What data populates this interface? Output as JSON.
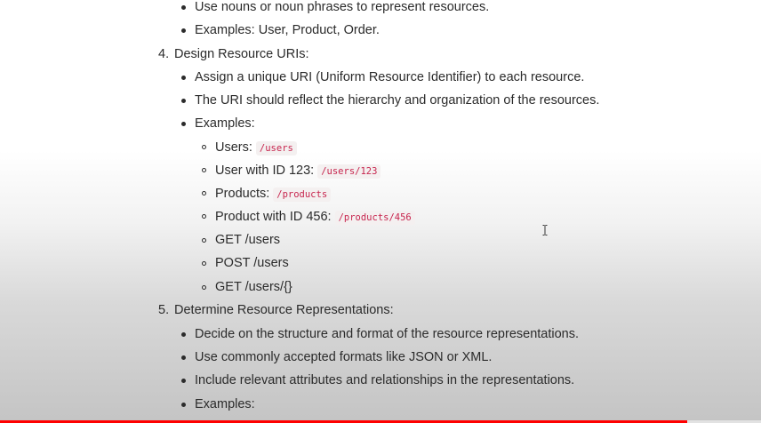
{
  "doc": {
    "intro_bullets": [
      "Use nouns or noun phrases to represent resources.",
      "Examples: User, Product, Order."
    ],
    "section4": {
      "number": "4.",
      "title": "Design Resource URIs:",
      "bullets": [
        "Assign a unique URI (Uniform Resource Identifier) to each resource.",
        "The URI should reflect the hierarchy and organization of the resources.",
        "Examples:"
      ],
      "examples": [
        {
          "label": "Users:",
          "code": "/users"
        },
        {
          "label": "User with ID 123:",
          "code": "/users/123"
        },
        {
          "label": "Products:",
          "code": "/products"
        },
        {
          "label": "Product with ID 456:",
          "code": "/products/456"
        },
        {
          "label": "GET /users"
        },
        {
          "label": "POST /users"
        },
        {
          "label": "GET /users/{}"
        }
      ]
    },
    "section5": {
      "number": "5.",
      "title": "Determine Resource Representations:",
      "bullets": [
        "Decide on the structure and format of the resource representations.",
        "Use commonly accepted formats like JSON or XML.",
        "Include relevant attributes and relationships in the representations.",
        "Examples:"
      ]
    }
  },
  "video": {
    "progress_fraction": 0.903,
    "progress_color": "#ff0000"
  },
  "cursor": {
    "icon": "text-cursor-icon"
  }
}
